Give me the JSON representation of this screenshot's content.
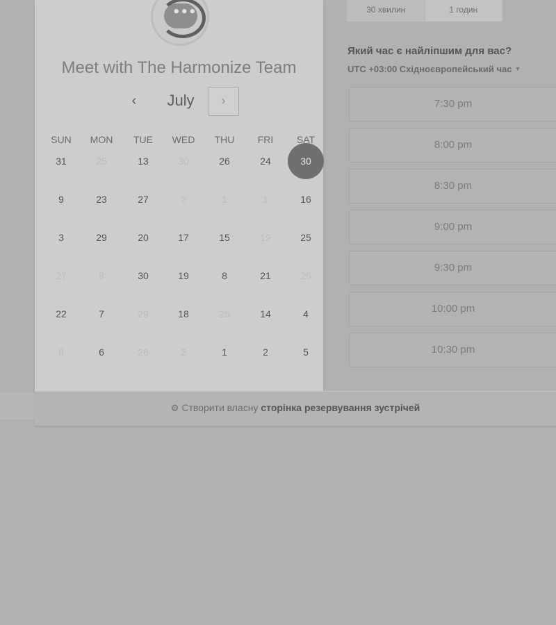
{
  "meeting": {
    "title": "Meet with The Harmonize Team",
    "avatar_icon": "chat-bubble-icon"
  },
  "calendar": {
    "month": "July",
    "prev_icon": "‹",
    "next_icon": "›",
    "weekdays": [
      "SUN",
      "MON",
      "TUE",
      "WED",
      "THU",
      "FRI",
      "SAT"
    ],
    "weeks": [
      [
        {
          "d": "31",
          "m": false
        },
        {
          "d": "25",
          "m": true
        },
        {
          "d": "13",
          "m": false
        },
        {
          "d": "30",
          "m": true
        },
        {
          "d": "26",
          "m": false
        },
        {
          "d": "24",
          "m": false
        },
        {
          "d": "30",
          "m": false,
          "sel": true
        }
      ],
      [
        {
          "d": "9",
          "m": false
        },
        {
          "d": "23",
          "m": false
        },
        {
          "d": "27",
          "m": false
        },
        {
          "d": "2",
          "m": true
        },
        {
          "d": "1",
          "m": true
        },
        {
          "d": "1",
          "m": true
        },
        {
          "d": "16",
          "m": false
        }
      ],
      [
        {
          "d": "3",
          "m": false
        },
        {
          "d": "29",
          "m": false
        },
        {
          "d": "20",
          "m": false
        },
        {
          "d": "17",
          "m": false
        },
        {
          "d": "15",
          "m": false
        },
        {
          "d": "19",
          "m": true
        },
        {
          "d": "25",
          "m": false
        }
      ],
      [
        {
          "d": "27",
          "m": true
        },
        {
          "d": "8",
          "m": true
        },
        {
          "d": "30",
          "m": false
        },
        {
          "d": "19",
          "m": false
        },
        {
          "d": "8",
          "m": false
        },
        {
          "d": "21",
          "m": false
        },
        {
          "d": "25",
          "m": true
        }
      ],
      [
        {
          "d": "22",
          "m": false
        },
        {
          "d": "7",
          "m": false
        },
        {
          "d": "29",
          "m": true
        },
        {
          "d": "18",
          "m": false
        },
        {
          "d": "25",
          "m": true
        },
        {
          "d": "14",
          "m": false
        },
        {
          "d": "4",
          "m": false
        }
      ],
      [
        {
          "d": "8",
          "m": true
        },
        {
          "d": "6",
          "m": false
        },
        {
          "d": "26",
          "m": true
        },
        {
          "d": "2",
          "m": true
        },
        {
          "d": "1",
          "m": false
        },
        {
          "d": "2",
          "m": false
        },
        {
          "d": "5",
          "m": false
        }
      ]
    ],
    "selected_color": "#6f6f6f"
  },
  "durations": [
    "30 хвилин",
    "1 годин"
  ],
  "availability": {
    "question": "Який час є найліпшим для вас?",
    "timezone": "UTC +03:00 Східноєвропейський час",
    "slots": [
      "7:30 pm",
      "8:00 pm",
      "8:30 pm",
      "9:00 pm",
      "9:30 pm",
      "10:00 pm",
      "10:30 pm"
    ]
  },
  "footer": {
    "prefix": "Створити власну",
    "link": "сторінка резервування зустрічей",
    "icon": "sprocket-icon"
  }
}
